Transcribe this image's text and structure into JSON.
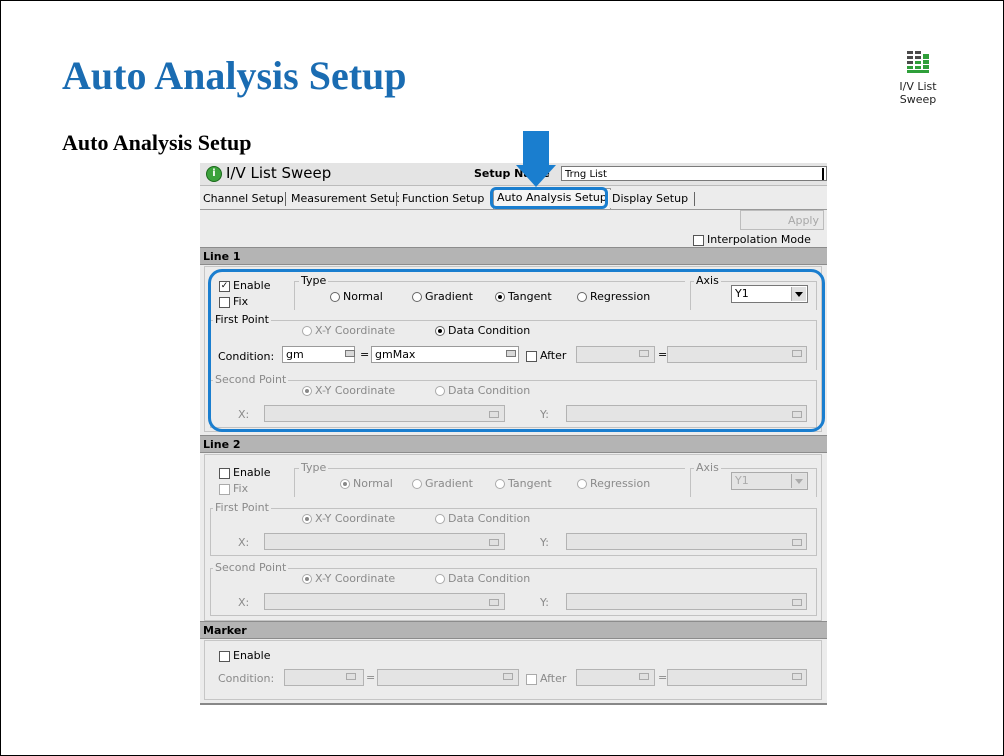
{
  "slide": {
    "title": "Auto Analysis Setup",
    "subtitle": "Auto Analysis Setup"
  },
  "app_icon": {
    "line1": "I/V List",
    "line2": "Sweep",
    "icon": "list-sweep-icon"
  },
  "window": {
    "app_name": "I/V List Sweep",
    "setup_name_label": "Setup Name",
    "setup_name_value": "Trng List",
    "tabs": [
      "Channel Setup",
      "Measurement Setup",
      "Function Setup",
      "Auto Analysis Setup",
      "Display Setup"
    ],
    "active_tab": "Auto Analysis Setup",
    "apply_label": "Apply",
    "interpolation_label": "Interpolation Mode",
    "interpolation_checked": false
  },
  "line1": {
    "header": "Line 1",
    "enable_label": "Enable",
    "enable_checked": true,
    "fix_label": "Fix",
    "fix_checked": false,
    "type_label": "Type",
    "type_options": [
      "Normal",
      "Gradient",
      "Tangent",
      "Regression"
    ],
    "type_selected": "Tangent",
    "axis_label": "Axis",
    "axis_value": "Y1",
    "first_point": {
      "label": "First Point",
      "options": [
        "X-Y Coordinate",
        "Data Condition"
      ],
      "selected": "Data Condition",
      "condition_label": "Condition:",
      "condition_var": "gm",
      "equals": "=",
      "condition_value": "gmMax",
      "after_label": "After",
      "after_checked": false,
      "after_equals": "="
    },
    "second_point": {
      "label": "Second Point",
      "options": [
        "X-Y Coordinate",
        "Data Condition"
      ],
      "selected": "X-Y Coordinate",
      "x_label": "X:",
      "y_label": "Y:"
    }
  },
  "line2": {
    "header": "Line 2",
    "enable_label": "Enable",
    "enable_checked": false,
    "fix_label": "Fix",
    "fix_checked": false,
    "type_label": "Type",
    "type_options": [
      "Normal",
      "Gradient",
      "Tangent",
      "Regression"
    ],
    "type_selected": "Normal",
    "axis_label": "Axis",
    "axis_value": "Y1",
    "first_point": {
      "label": "First Point",
      "options": [
        "X-Y Coordinate",
        "Data Condition"
      ],
      "selected": "X-Y Coordinate",
      "x_label": "X:",
      "y_label": "Y:"
    },
    "second_point": {
      "label": "Second Point",
      "options": [
        "X-Y Coordinate",
        "Data Condition"
      ],
      "selected": "X-Y Coordinate",
      "x_label": "X:",
      "y_label": "Y:"
    }
  },
  "marker": {
    "header": "Marker",
    "enable_label": "Enable",
    "enable_checked": false,
    "condition_label": "Condition:",
    "equals": "=",
    "after_label": "After",
    "after_checked": false,
    "after_equals": "="
  },
  "colors": {
    "title": "#1a6cb2",
    "highlight": "#1a7ecf",
    "section_header": "#b4b4b4"
  }
}
